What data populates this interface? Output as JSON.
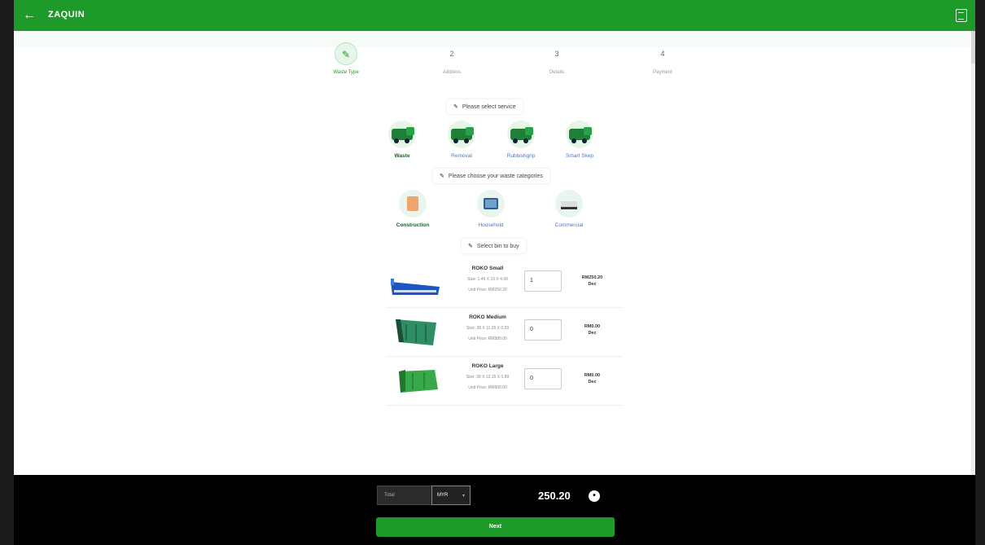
{
  "header": {
    "title": "ZAQUIN",
    "back_icon": "arrow-left-icon",
    "menu_icon": "document-icon"
  },
  "steps": [
    {
      "number": "✎",
      "label": "Waste Type"
    },
    {
      "number": "2",
      "label": "Address"
    },
    {
      "number": "3",
      "label": "Details"
    },
    {
      "number": "4",
      "label": "Payment"
    }
  ],
  "sections": {
    "service": "Please select service",
    "category": "Please choose your waste categories",
    "bin": "Select bin to buy"
  },
  "services": [
    {
      "label": "Waste",
      "selected": true
    },
    {
      "label": "Removal",
      "selected": false
    },
    {
      "label": "Rubbishgrip",
      "selected": false
    },
    {
      "label": "Smart Skep",
      "selected": false
    }
  ],
  "categories": [
    {
      "label": "Construction",
      "selected": true
    },
    {
      "label": "Household",
      "selected": false
    },
    {
      "label": "Commercial",
      "selected": false
    }
  ],
  "bins": [
    {
      "name": "ROKO Small",
      "size": "Size: 1.46 X 19 X 4.99",
      "unit_price": "Unit Price: RM250.20",
      "quantity": "1",
      "total": "RM250.20",
      "unit": "Dec"
    },
    {
      "name": "ROKO Medium",
      "size": "Size: 38 X 11.35 X 0.59",
      "unit_price": "Unit Price: RM580.00",
      "quantity": "0",
      "total": "RM0.00",
      "unit": "Dec"
    },
    {
      "name": "ROKO Large",
      "size": "Size: 38 X 12.15 X 0.89",
      "unit_price": "Unit Price: RM600.00",
      "quantity": "0",
      "total": "RM0.00",
      "unit": "Dec"
    }
  ],
  "footer": {
    "total_label": "Total",
    "currency": "MYR",
    "amount": "250.20",
    "next_label": "Next"
  },
  "colors": {
    "primary": "#1e9a2a",
    "bar": "#000000"
  }
}
